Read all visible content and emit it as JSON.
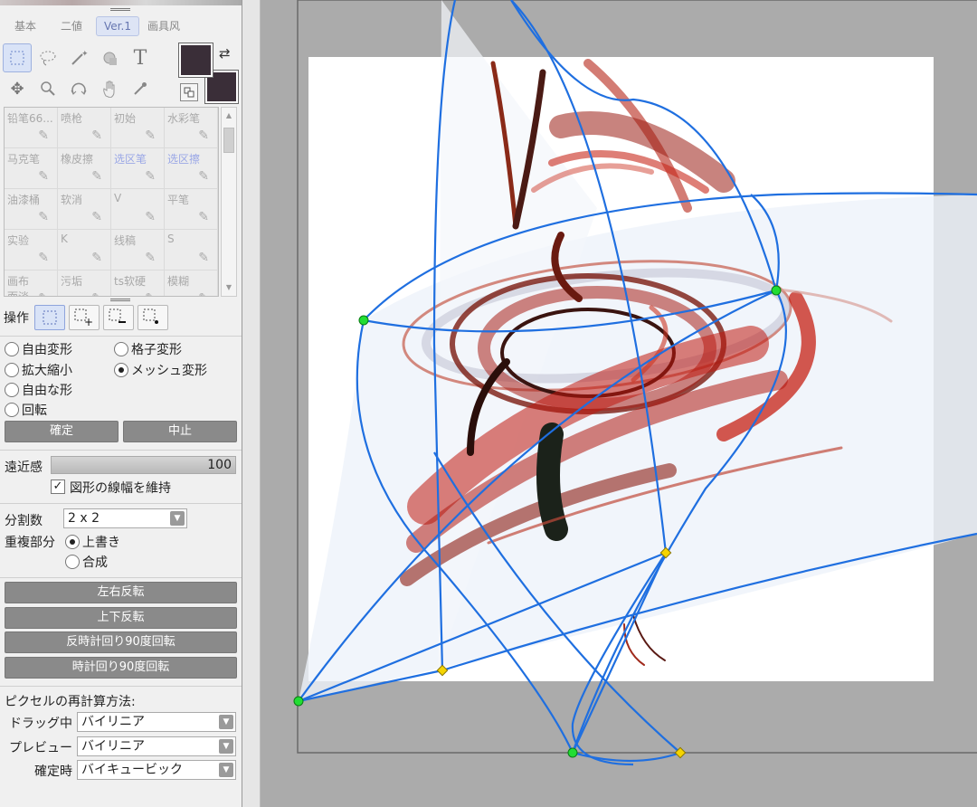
{
  "tabs": [
    "基本",
    "二値",
    "Ver.1",
    "画具风"
  ],
  "tab_active": 2,
  "tools": {
    "row1": [
      "rect-select-icon",
      "lasso-icon",
      "magic-wand-icon",
      "select-pen-icon",
      "text-icon"
    ],
    "row2": [
      "move-icon",
      "zoom-icon",
      "rotate-view-icon",
      "hand-icon",
      "eyedropper-icon"
    ],
    "text_glyph": "T"
  },
  "colors": {
    "foreground": "#3a2e38",
    "background": "#3a2e38",
    "mesh_line": "#1f6fe0",
    "node_green": "#22dd33",
    "node_yellow": "#f5d400"
  },
  "brushes": [
    {
      "label": "铅笔66...",
      "icon": "pencil-icon"
    },
    {
      "label": "喷枪",
      "icon": "airbrush-icon"
    },
    {
      "label": "初始",
      "icon": "brush-icon"
    },
    {
      "label": "水彩笔",
      "icon": "watercolor-icon"
    },
    {
      "label": "马克笔",
      "icon": "marker-icon"
    },
    {
      "label": "橡皮擦",
      "icon": "eraser-icon"
    },
    {
      "label": "选区笔",
      "icon": "selection-pen-icon",
      "blue": true
    },
    {
      "label": "选区擦",
      "icon": "selection-eraser-icon",
      "blue": true
    },
    {
      "label": "油漆桶",
      "icon": "bucket-icon"
    },
    {
      "label": "软消",
      "icon": "soft-eraser-icon"
    },
    {
      "label": "V",
      "icon": "brush-icon"
    },
    {
      "label": "平笔",
      "icon": "flat-brush-icon"
    },
    {
      "label": "实验",
      "icon": "brush-icon"
    },
    {
      "label": "K",
      "icon": "brush-icon"
    },
    {
      "label": "线稿",
      "icon": "brush-icon"
    },
    {
      "label": "S",
      "icon": "brush-icon"
    },
    {
      "label": "画布\n而淡",
      "icon": "brush-icon"
    },
    {
      "label": "污垢",
      "icon": "brush-icon"
    },
    {
      "label": "ts软硬",
      "icon": "brush-icon"
    },
    {
      "label": "模糊",
      "icon": "blur-icon"
    }
  ],
  "operation": {
    "label": "操作",
    "buttons": [
      "select-replace-icon",
      "select-add-icon",
      "select-subtract-icon",
      "select-intersect-icon"
    ],
    "selected": 0
  },
  "transform_modes": {
    "free_transform": "自由変形",
    "grid_transform": "格子変形",
    "scale": "拡大縮小",
    "mesh_transform": "メッシュ変形",
    "free_shape": "自由な形",
    "rotate": "回転",
    "selected": "mesh_transform"
  },
  "actions": {
    "confirm": "確定",
    "cancel": "中止"
  },
  "perspective": {
    "label": "遠近感",
    "value": "100"
  },
  "keep_line_width": {
    "label": "図形の線幅を維持",
    "checked": true
  },
  "divisions": {
    "label": "分割数",
    "value": "2 x 2"
  },
  "overlap": {
    "label": "重複部分",
    "overwrite": "上書き",
    "composite": "合成",
    "selected": "overwrite"
  },
  "flip_buttons": [
    "左右反転",
    "上下反転",
    "反時計回り90度回転",
    "時計回り90度回転"
  ],
  "resample": {
    "title": "ピクセルの再計算方法:",
    "rows": [
      {
        "label": "ドラッグ中",
        "value": "バイリニア"
      },
      {
        "label": "プレビュー",
        "value": "バイリニア"
      },
      {
        "label": "確定時",
        "value": "バイキュービック"
      }
    ]
  }
}
